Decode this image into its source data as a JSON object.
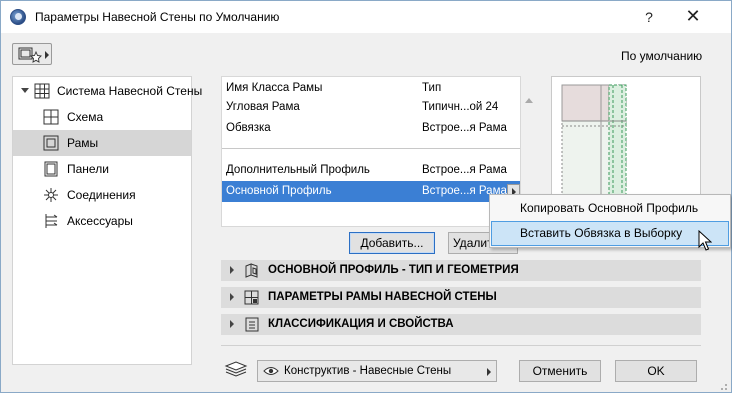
{
  "window": {
    "title": "Параметры Навесной Стены по Умолчанию",
    "help": "?",
    "close": "✕"
  },
  "toolbar": {
    "default_label": "По умолчанию"
  },
  "sidebar": {
    "items": [
      {
        "label": "Система Навесной Стены",
        "icon": "grid-icon",
        "expanded": true
      },
      {
        "label": "Схема",
        "icon": "scheme-icon"
      },
      {
        "label": "Рамы",
        "icon": "frame-icon",
        "selected": true
      },
      {
        "label": "Панели",
        "icon": "panel-icon"
      },
      {
        "label": "Соединения",
        "icon": "junction-icon"
      },
      {
        "label": "Аксессуары",
        "icon": "accessory-icon"
      }
    ]
  },
  "frames": {
    "rows": [
      {
        "name": "Имя Класса Рамы",
        "value": "Тип"
      },
      {
        "name": "Угловая Рама",
        "value": "Типичн...ой 24"
      },
      {
        "name": "Обвязка",
        "value": "Встрое...я Рама"
      },
      {
        "name": "Дополнительный Профиль",
        "value": "Встрое...я Рама"
      },
      {
        "name": "Основной Профиль",
        "value": "Встрое...я Рама",
        "selected": true
      }
    ],
    "add_label": "Добавить...",
    "delete_label": "Удалить"
  },
  "context_menu": {
    "items": [
      {
        "label": "Копировать Основной Профиль"
      },
      {
        "label": "Вставить Обвязка в Выборку",
        "highlighted": true
      }
    ]
  },
  "sections": [
    {
      "label": "ОСНОВНОЙ ПРОФИЛЬ - ТИП И ГЕОМЕТРИЯ",
      "icon": "profile-geometry-icon"
    },
    {
      "label": "ПАРАМЕТРЫ РАМЫ НАВЕСНОЙ СТЕНЫ",
      "icon": "frame-params-icon"
    },
    {
      "label": "КЛАССИФИКАЦИЯ И СВОЙСТВА",
      "icon": "classification-icon"
    }
  ],
  "footer": {
    "layer_label": "Конструктив - Навесные Стены",
    "cancel_label": "Отменить",
    "ok_label": "OK"
  },
  "colors": {
    "selection": "#3b7fd4",
    "menu_highlight": "#cce4f7",
    "sidebar_selected": "#d6d6d6"
  }
}
